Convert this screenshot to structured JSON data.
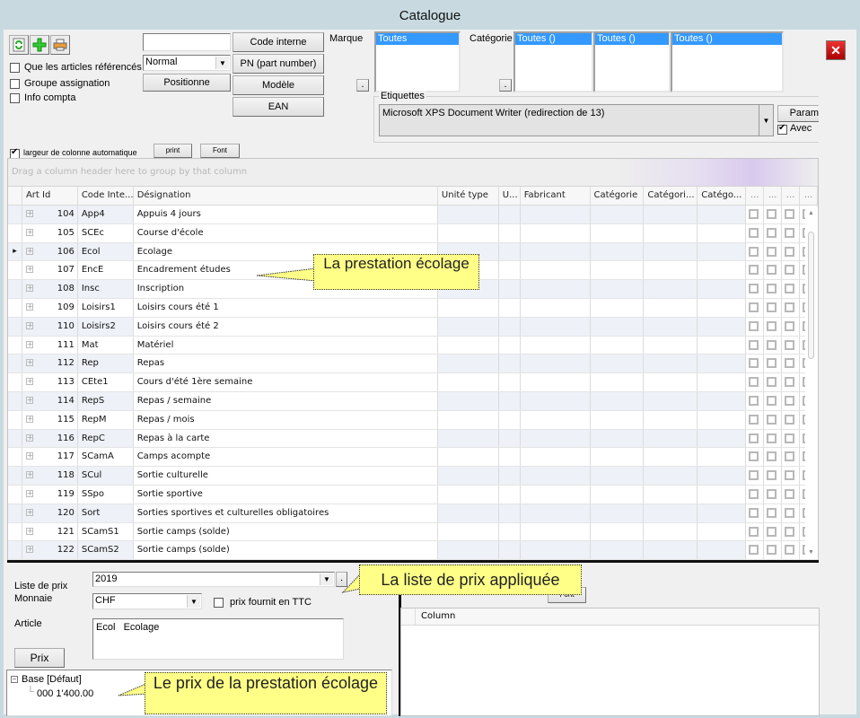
{
  "window": {
    "title": "Catalogue"
  },
  "toolbar": {
    "icons": [
      "refresh-icon",
      "add-icon",
      "print-icon"
    ],
    "search_value": "",
    "mode_select": "Normal",
    "positionne_label": "Positionne",
    "code_interne_label": "Code interne",
    "pn_label": "PN (part number)",
    "modele_label": "Modèle",
    "ean_label": "EAN",
    "checkboxes": [
      {
        "label": "Que les articles référencés",
        "checked": false
      },
      {
        "label": "Groupe assignation",
        "checked": false
      },
      {
        "label": "Info compta",
        "checked": false
      }
    ],
    "auto_width_label": "largeur de colonne automatique",
    "auto_width_checked": true,
    "print_label": "print",
    "font_label": "Font"
  },
  "filters": {
    "marque_label": "Marque",
    "marque_selected": "Toutes",
    "categorie_label": "Catégorie",
    "categorie_lists": [
      "Toutes ()",
      "Toutes ()",
      "Toutes ()"
    ],
    "dot_button": "."
  },
  "etiquettes": {
    "group_label": "Etiquettes",
    "printer": "Microsoft XPS Document Writer (redirection de 13)",
    "param_label": "Param",
    "avec_label": "Avec",
    "avec_checked": true
  },
  "grid": {
    "group_hint": "Drag a column header here to group by that column",
    "columns": [
      "Art Id",
      "Code Inte...",
      "Désignation",
      "Unité type",
      "U...",
      "Fabricant",
      "Catégorie",
      "Catégori...",
      "Catégo...",
      "...",
      "...",
      "...",
      "..."
    ],
    "selected_row_index": 2,
    "rows": [
      {
        "id": "104",
        "code": "App4",
        "designation": "Appuis 4 jours"
      },
      {
        "id": "105",
        "code": "SCEc",
        "designation": "Course d'école"
      },
      {
        "id": "106",
        "code": "Ecol",
        "designation": "Ecolage"
      },
      {
        "id": "107",
        "code": "EncE",
        "designation": "Encadrement études"
      },
      {
        "id": "108",
        "code": "Insc",
        "designation": "Inscription"
      },
      {
        "id": "109",
        "code": "Loisirs1",
        "designation": "Loisirs cours été 1"
      },
      {
        "id": "110",
        "code": "Loisirs2",
        "designation": "Loisirs cours été 2"
      },
      {
        "id": "111",
        "code": "Mat",
        "designation": "Matériel"
      },
      {
        "id": "112",
        "code": "Rep",
        "designation": "Repas"
      },
      {
        "id": "113",
        "code": "CEte1",
        "designation": "Cours d'été 1ère semaine"
      },
      {
        "id": "114",
        "code": "RepS",
        "designation": "Repas / semaine"
      },
      {
        "id": "115",
        "code": "RepM",
        "designation": "Repas / mois"
      },
      {
        "id": "116",
        "code": "RepC",
        "designation": "Repas à la carte"
      },
      {
        "id": "117",
        "code": "SCamA",
        "designation": "Camps acompte"
      },
      {
        "id": "118",
        "code": "SCul",
        "designation": "Sortie culturelle"
      },
      {
        "id": "119",
        "code": "SSpo",
        "designation": "Sortie sportive"
      },
      {
        "id": "120",
        "code": "Sort",
        "designation": "Sorties sportives et culturelles obligatoires"
      },
      {
        "id": "121",
        "code": "SCamS1",
        "designation": "Sortie camps (solde)"
      },
      {
        "id": "122",
        "code": "SCamS2",
        "designation": "Sortie camps (solde)"
      }
    ]
  },
  "prices": {
    "liste_label": "Liste de prix",
    "liste_value": "2019",
    "monnaie_label": "Monnaie",
    "monnaie_value": "CHF",
    "ttc_label": "prix fournit en TTC",
    "ttc_checked": false,
    "article_label": "Article",
    "article_value": "Ecol   Ecolage",
    "prix_button": "Prix",
    "tree_root": "Base [Défaut]",
    "tree_child": "000 1'400.00",
    "font_label": "Font",
    "bottom_column": "Column"
  },
  "callouts": {
    "prestation": "La prestation écolage",
    "liste": "La liste de prix appliquée",
    "prix": "Le prix de la prestation écolage"
  }
}
